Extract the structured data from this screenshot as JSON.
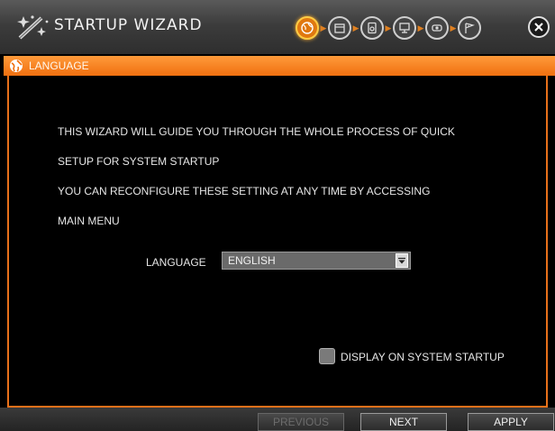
{
  "window": {
    "title": "STARTUP WIZARD",
    "steps": [
      {
        "icon": "globe-icon",
        "active": true
      },
      {
        "icon": "calendar-icon",
        "active": false
      },
      {
        "icon": "disk-icon",
        "active": false
      },
      {
        "icon": "network-monitor-icon",
        "active": false
      },
      {
        "icon": "camera-icon",
        "active": false
      },
      {
        "icon": "flag-icon",
        "active": false
      }
    ]
  },
  "section": {
    "title": "LANGUAGE"
  },
  "content": {
    "line1": "THIS WIZARD WILL GUIDE YOU THROUGH THE WHOLE PROCESS OF QUICK",
    "line2": "SETUP FOR SYSTEM STARTUP",
    "line3": "YOU CAN RECONFIGURE THESE SETTING AT ANY TIME BY ACCESSING",
    "line4": "MAIN MENU",
    "language_label": "LANGUAGE",
    "language_value": "ENGLISH",
    "display_label": "DISPLAY ON SYSTEM STARTUP",
    "display_checked": false
  },
  "footer": {
    "previous_label": "PREVIOUS",
    "next_label": "NEXT",
    "apply_label": "APPLY"
  },
  "colors": {
    "accent": "#f07010",
    "background": "#000000"
  }
}
